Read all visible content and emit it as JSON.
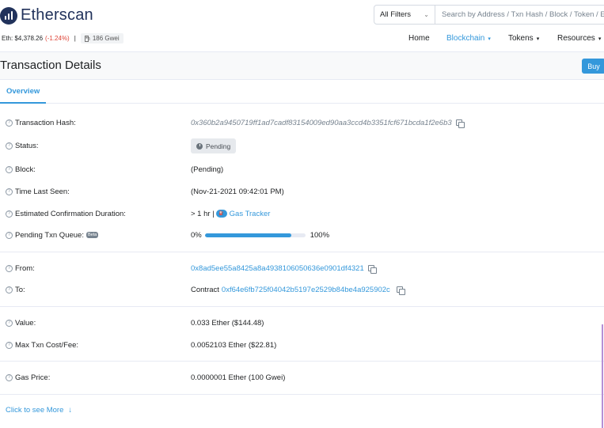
{
  "header": {
    "logo_text": "Etherscan",
    "eth_price_label": "Eth: $4,378.26",
    "eth_change": "(-1.24%)",
    "separator": "|",
    "gas": "186 Gwei",
    "filter_label": "All Filters",
    "search_placeholder": "Search by Address / Txn Hash / Block / Token / Ens",
    "nav": [
      {
        "label": "Home"
      },
      {
        "label": "Blockchain"
      },
      {
        "label": "Tokens"
      },
      {
        "label": "Resources"
      }
    ]
  },
  "page": {
    "title": "Transaction Details",
    "buy_label": "Buy",
    "tab": "Overview"
  },
  "details": {
    "hash_label": "Transaction Hash:",
    "hash_value": "0x360b2a9450719ff1ad7cadf83154009ed90aa3ccd4b3351fcf671bcda1f2e6b3",
    "status_label": "Status:",
    "status_value": "Pending",
    "block_label": "Block:",
    "block_value": "(Pending)",
    "time_label": "Time Last Seen:",
    "time_value": "(Nov-21-2021 09:42:01 PM)",
    "duration_label": "Estimated Confirmation Duration:",
    "duration_value": "> 1 hr |",
    "gas_tracker": "Gas Tracker",
    "queue_label": "Pending Txn Queue:",
    "queue_beta": "Beta",
    "queue_start": "0%",
    "queue_end": "100%",
    "queue_fill": 0.86,
    "from_label": "From:",
    "from_value": "0x8ad5ee55a8425a8a4938106050636e0901df4321",
    "to_label": "To:",
    "to_prefix": "Contract",
    "to_value": "0xf64e6fb725f04042b5197e2529b84be4a925902c",
    "value_label": "Value:",
    "value_value": "0.033 Ether ($144.48)",
    "maxfee_label": "Max Txn Cost/Fee:",
    "maxfee_value": "0.0052103 Ether ($22.81)",
    "gasprice_label": "Gas Price:",
    "gasprice_value": "0.0000001 Ether (100 Gwei)",
    "see_more": "Click to see More"
  }
}
